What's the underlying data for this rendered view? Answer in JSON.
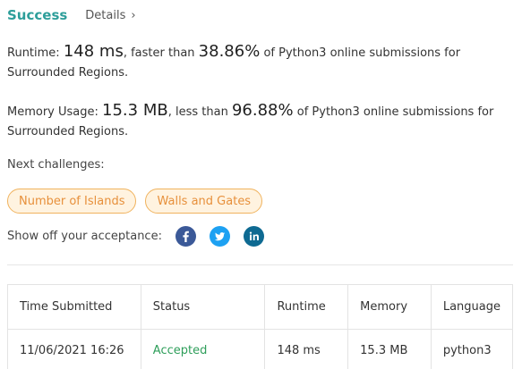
{
  "header": {
    "status": "Success",
    "details_label": "Details",
    "chevron": "›"
  },
  "runtime": {
    "label": "Runtime:",
    "value": "148 ms",
    "mid": ", faster than",
    "percent": "38.86%",
    "tail": "of Python3 online submissions for Surrounded Regions."
  },
  "memory": {
    "label": "Memory Usage:",
    "value": "15.3 MB",
    "mid": ", less than",
    "percent": "96.88%",
    "tail": "of Python3 online submissions for Surrounded Regions."
  },
  "next": {
    "label": "Next challenges:",
    "challenges": [
      "Number of Islands",
      "Walls and Gates"
    ]
  },
  "share": {
    "label": "Show off your acceptance:",
    "icons": [
      "facebook-icon",
      "twitter-icon",
      "linkedin-icon"
    ],
    "colors": {
      "facebook": "#3b5998",
      "twitter": "#1da1f2",
      "linkedin": "#0e6a92"
    }
  },
  "table": {
    "headers": [
      "Time Submitted",
      "Status",
      "Runtime",
      "Memory",
      "Language"
    ],
    "rows": [
      [
        "11/06/2021 16:26",
        "Accepted",
        "148 ms",
        "15.3 MB",
        "python3"
      ]
    ]
  },
  "colors": {
    "success": "#2d9e9a",
    "accepted": "#2e9e5a",
    "chip_text": "#e7903b",
    "chip_border": "#f0b35e"
  }
}
